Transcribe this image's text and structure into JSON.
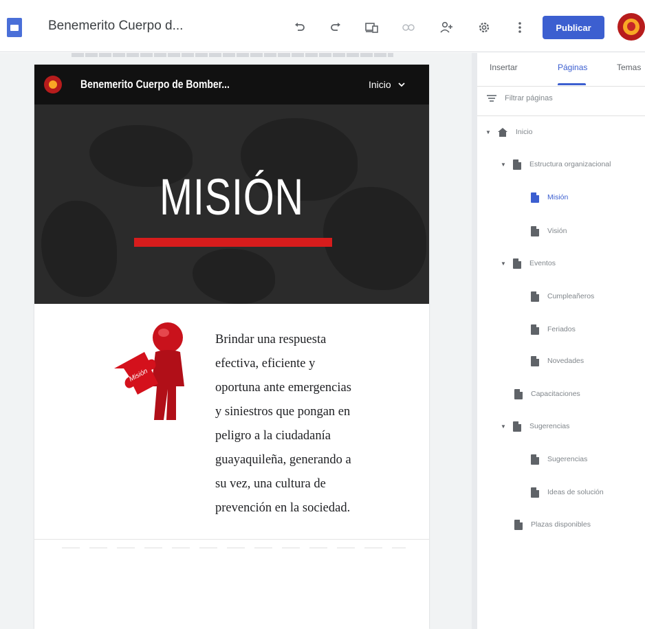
{
  "toolbar": {
    "doc_title": "Benemerito Cuerpo d...",
    "undo_icon": "undo-icon",
    "redo_icon": "redo-icon",
    "preview_icon": "preview-icon",
    "link_icon": "link-icon",
    "share_icon": "add-person-icon",
    "settings_icon": "settings-gear-icon",
    "more_icon": "more-vert-icon",
    "publish_label": "Publicar",
    "accent": "#3c5fd0"
  },
  "site": {
    "name": "Benemerito Cuerpo de Bomber...",
    "nav_label": "Inicio",
    "hero_title": "MISIÓN",
    "hero_bar_color": "#d71c1c",
    "figure_label": "Misión",
    "mission_lines": [
      "Brindar una respuesta",
      "efectiva, eficiente y",
      "oportuna ante emergencias",
      "y siniestros que pongan en",
      "peligro a la ciudadanía",
      "guayaquileña, generando a",
      "su vez, una cultura de",
      "prevención en la sociedad."
    ]
  },
  "panel": {
    "tabs": [
      {
        "label": "Insertar",
        "active": false
      },
      {
        "label": "Páginas",
        "active": true
      },
      {
        "label": "Temas",
        "active": false
      }
    ],
    "filter_placeholder": "Filtrar páginas",
    "tree": [
      {
        "label": "Inicio",
        "level": 0,
        "expanded": true,
        "icon": "home-icon",
        "active": false
      },
      {
        "label": "Estructura organizacional",
        "level": 1,
        "expanded": true,
        "icon": "page-icon",
        "active": false
      },
      {
        "label": "Misión",
        "level": 2,
        "icon": "page-icon",
        "active": true
      },
      {
        "label": "Visión",
        "level": 2,
        "icon": "page-icon",
        "active": false
      },
      {
        "label": "Eventos",
        "level": 1,
        "expanded": true,
        "icon": "page-icon",
        "active": false
      },
      {
        "label": "Cumpleañeros",
        "level": 2,
        "icon": "page-icon",
        "active": false
      },
      {
        "label": "Feriados",
        "level": 2,
        "icon": "page-icon",
        "active": false
      },
      {
        "label": "Novedades",
        "level": 2,
        "icon": "page-icon",
        "active": false
      },
      {
        "label": "Capacitaciones",
        "level": 1,
        "icon": "page-icon",
        "active": false
      },
      {
        "label": "Sugerencias",
        "level": 1,
        "expanded": true,
        "icon": "page-icon",
        "active": false
      },
      {
        "label": "Sugerencias",
        "level": 2,
        "icon": "page-icon",
        "active": false
      },
      {
        "label": "Ideas de solución",
        "level": 2,
        "icon": "page-icon",
        "active": false
      },
      {
        "label": "Plazas disponibles",
        "level": 1,
        "icon": "page-icon",
        "active": false
      }
    ]
  }
}
